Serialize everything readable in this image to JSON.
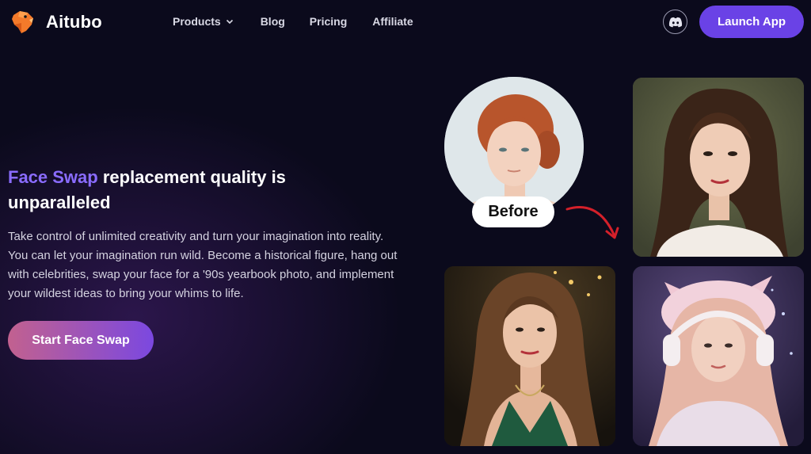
{
  "brand": {
    "name": "Aitubo"
  },
  "nav": {
    "items": [
      {
        "label": "Products",
        "has_dropdown": true,
        "icon": "chevron-down-icon"
      },
      {
        "label": "Blog"
      },
      {
        "label": "Pricing"
      },
      {
        "label": "Affiliate"
      }
    ],
    "discord_icon": "discord-icon",
    "launch_label": "Launch App"
  },
  "hero": {
    "title_accent": "Face Swap",
    "title_rest": " replacement quality is unparalleled",
    "description": "Take control of unlimited creativity and turn your imagination into reality. You can let your imagination run wild. Become a historical figure, hang out with celebrities, swap your face for a '90s yearbook photo, and implement your wildest ideas to bring your whims to life.",
    "cta_label": "Start Face Swap"
  },
  "gallery": {
    "before_label": "Before",
    "images": [
      "before-portrait",
      "result-vintage-portrait",
      "result-green-dress-portrait",
      "result-cat-ears-headphones-portrait"
    ]
  },
  "colors": {
    "background": "#0b0a1c",
    "accent": "#8a6cff",
    "launch_button": "#6a42e6",
    "cta_gradient_start": "#c2618f",
    "cta_gradient_end": "#7b48e0",
    "arrow": "#d4202a"
  }
}
